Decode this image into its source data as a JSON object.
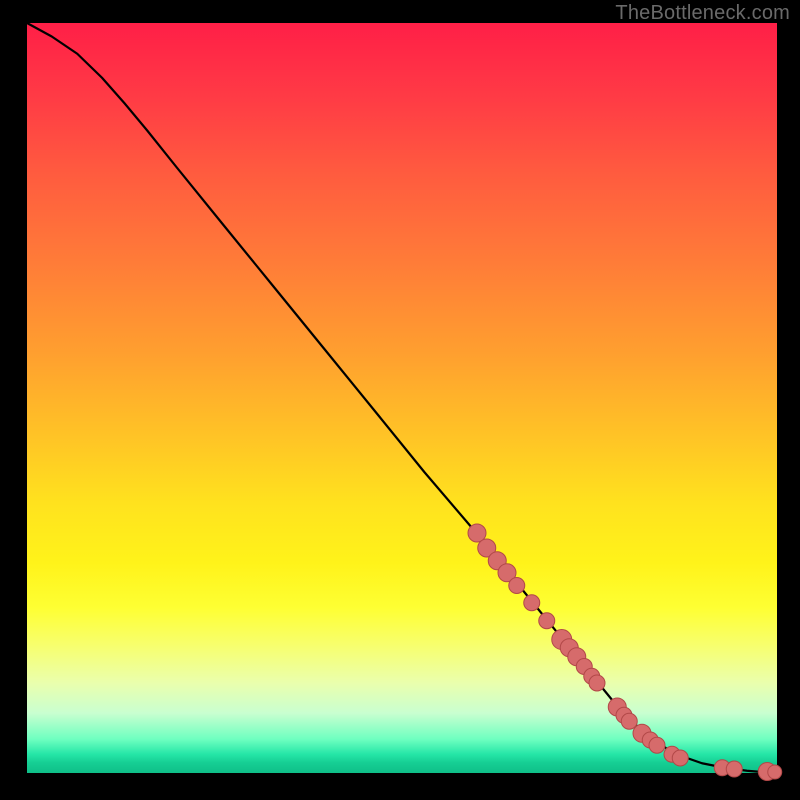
{
  "watermark": "TheBottleneck.com",
  "chart_data": {
    "type": "line",
    "title": "",
    "xlabel": "",
    "ylabel": "",
    "xlim": [
      0,
      100
    ],
    "ylim": [
      0,
      100
    ],
    "grid": false,
    "legend": false,
    "series": [
      {
        "name": "curve",
        "x": [
          0,
          3.3,
          6.7,
          10,
          13,
          16,
          20,
          26,
          33,
          40,
          47,
          53,
          60,
          66,
          73,
          80,
          86,
          90,
          93,
          96,
          98,
          100
        ],
        "y": [
          100,
          98.2,
          95.9,
          92.7,
          89.3,
          85.7,
          80.7,
          73.3,
          64.7,
          56.1,
          47.5,
          40.1,
          31.9,
          24.5,
          15.9,
          7.3,
          2.7,
          1.3,
          0.7,
          0.3,
          0.13,
          0.07
        ]
      }
    ],
    "markers": [
      {
        "x": 60.0,
        "y": 32.0,
        "r": 9
      },
      {
        "x": 61.3,
        "y": 30.0,
        "r": 9
      },
      {
        "x": 62.7,
        "y": 28.3,
        "r": 9
      },
      {
        "x": 64.0,
        "y": 26.7,
        "r": 9
      },
      {
        "x": 65.3,
        "y": 25.0,
        "r": 8
      },
      {
        "x": 67.3,
        "y": 22.7,
        "r": 8
      },
      {
        "x": 69.3,
        "y": 20.3,
        "r": 8
      },
      {
        "x": 71.3,
        "y": 17.8,
        "r": 10
      },
      {
        "x": 72.3,
        "y": 16.7,
        "r": 9
      },
      {
        "x": 73.3,
        "y": 15.5,
        "r": 9
      },
      {
        "x": 74.3,
        "y": 14.2,
        "r": 8
      },
      {
        "x": 75.3,
        "y": 12.9,
        "r": 8
      },
      {
        "x": 76.0,
        "y": 12.0,
        "r": 8
      },
      {
        "x": 78.7,
        "y": 8.8,
        "r": 9
      },
      {
        "x": 79.6,
        "y": 7.7,
        "r": 8
      },
      {
        "x": 80.3,
        "y": 6.9,
        "r": 8
      },
      {
        "x": 82.0,
        "y": 5.3,
        "r": 9
      },
      {
        "x": 83.1,
        "y": 4.4,
        "r": 8
      },
      {
        "x": 84.0,
        "y": 3.7,
        "r": 8
      },
      {
        "x": 86.0,
        "y": 2.5,
        "r": 8
      },
      {
        "x": 87.1,
        "y": 2.0,
        "r": 8
      },
      {
        "x": 92.7,
        "y": 0.7,
        "r": 8
      },
      {
        "x": 94.3,
        "y": 0.53,
        "r": 8
      },
      {
        "x": 98.7,
        "y": 0.2,
        "r": 9
      },
      {
        "x": 99.7,
        "y": 0.13,
        "r": 7
      }
    ],
    "marker_style": {
      "fill": "#d66b6b",
      "stroke": "#b24848"
    },
    "line_style": {
      "stroke": "#000000",
      "width": 2.2
    }
  }
}
